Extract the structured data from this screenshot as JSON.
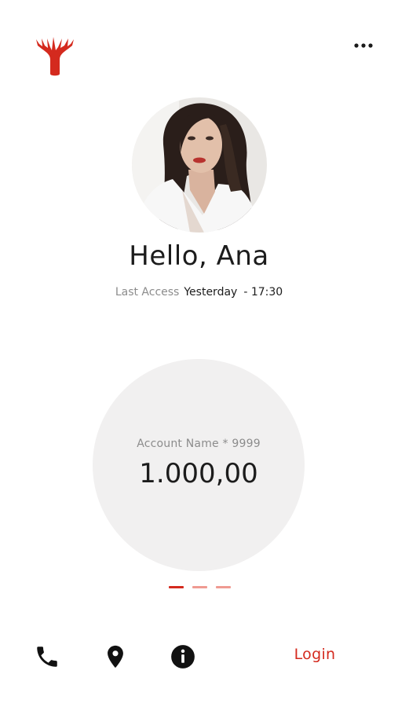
{
  "header": {
    "logo_icon": "tree-logo-icon",
    "menu_icon": "more-horizontal-icon"
  },
  "profile": {
    "greeting": "Hello, Ana",
    "last_access_label": "Last Access",
    "last_access_day": "Yesterday",
    "last_access_time": "- 17:30"
  },
  "account": {
    "name": "Account Name * 9999",
    "balance": "1.000,00"
  },
  "pager": {
    "pages": 3,
    "active_index": 0
  },
  "bottom_bar": {
    "icons": [
      "phone-icon",
      "location-pin-icon",
      "info-icon"
    ],
    "login_label": "Login"
  },
  "colors": {
    "accent": "#d42a1e",
    "accent_light": "#ef9a92",
    "balance_bg": "#f1f0f0"
  }
}
